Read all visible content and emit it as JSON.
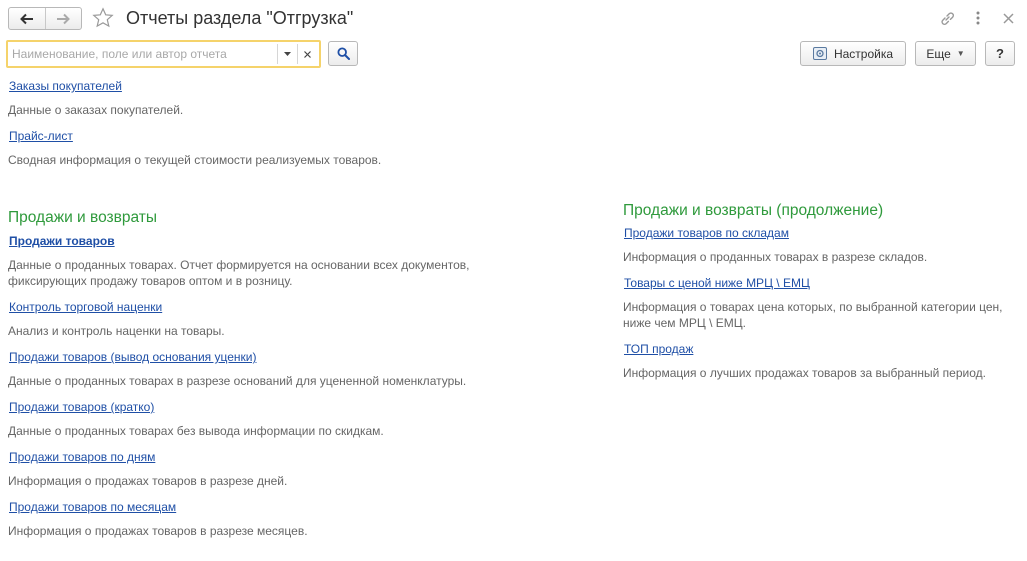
{
  "window": {
    "title": "Отчеты раздела \"Отгрузка\""
  },
  "search": {
    "placeholder": "Наименование, поле или автор отчета",
    "value": ""
  },
  "toolbar": {
    "settings_label": "Настройка",
    "more_label": "Еще",
    "help_label": "?"
  },
  "top_reports": [
    {
      "title": "Заказы покупателей",
      "description": "Данные о заказах покупателей."
    },
    {
      "title": "Прайс-лист",
      "description": "Сводная информация о текущей стоимости реализуемых товаров."
    }
  ],
  "left_group": {
    "title": "Продажи и возвраты",
    "reports": [
      {
        "title": "Продажи товаров",
        "description": "Данные о проданных товарах. Отчет формируется на основании всех документов, фиксирующих продажу товаров оптом и в розницу."
      },
      {
        "title": "Контроль торговой наценки",
        "description": "Анализ и контроль наценки на товары."
      },
      {
        "title": "Продажи товаров (вывод основания уценки)",
        "description": "Данные о проданных товарах в разрезе оснований для уцененной номенклатуры."
      },
      {
        "title": "Продажи товаров (кратко)",
        "description": "Данные о проданных товарах без вывода информации по скидкам."
      },
      {
        "title": "Продажи товаров по дням",
        "description": "Информация о продажах товаров в разрезе дней."
      },
      {
        "title": "Продажи товаров по месяцам",
        "description": "Информация о продажах товаров в разрезе месяцев."
      }
    ]
  },
  "right_group": {
    "title": "Продажи и возвраты (продолжение)",
    "reports": [
      {
        "title": "Продажи товаров по складам",
        "description": "Информация о проданных товарах в разрезе складов."
      },
      {
        "title": "Товары с ценой ниже МРЦ \\ ЕМЦ",
        "description": "Информация о товарах цена которых, по выбранной категории цен, ниже чем МРЦ \\ ЕМЦ."
      },
      {
        "title": "ТОП продаж",
        "description": "Информация о лучших продажах товаров за выбранный период."
      }
    ]
  },
  "colors": {
    "link": "#1f4fa6",
    "group_title": "#2f9a3c",
    "description": "#666666",
    "search_focus_border": "#f5d36b"
  }
}
